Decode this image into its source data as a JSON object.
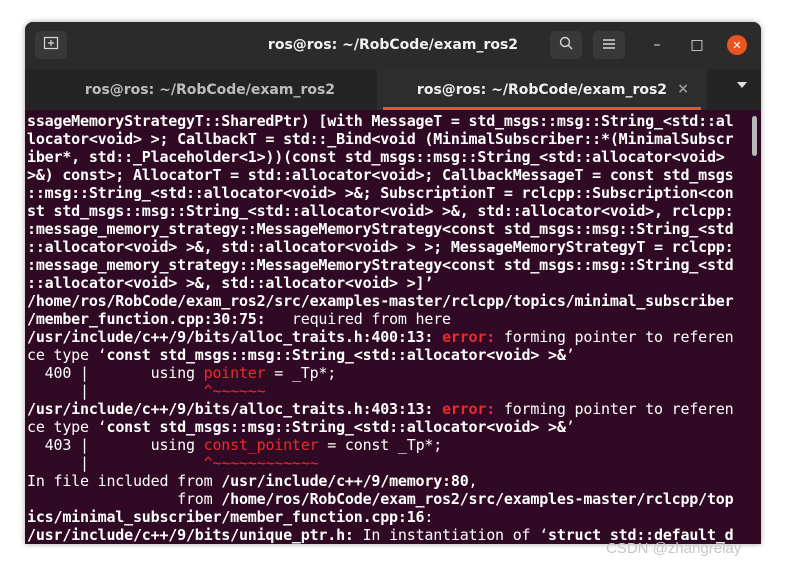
{
  "window": {
    "title": "ros@ros: ~/RobCode/exam_ros2",
    "new_tab_icon": "new-tab-icon",
    "search_icon": "search-icon",
    "menu_icon": "hamburger-menu-icon",
    "minimize": "–",
    "maximize": "□",
    "close": "✕"
  },
  "tabs": [
    {
      "label": "ros@ros: ~/RobCode/exam_ros2",
      "active": false
    },
    {
      "label": "ros@ros: ~/RobCode/exam_ros2",
      "active": true,
      "close": "×"
    }
  ],
  "terminal": {
    "lines": [
      "ssageMemoryStrategyT::SharedPtr) [with MessageT = std_msgs::msg::String_<std::al",
      "locator<void> >; CallbackT = std::_Bind<void (MinimalSubscriber::*(MinimalSubscr",
      "iber*, std::_Placeholder<1>))(const std_msgs::msg::String_<std::allocator<void> ",
      ">&) const>; AllocatorT = std::allocator<void>; CallbackMessageT = const std_msgs",
      "::msg::String_<std::allocator<void> >&; SubscriptionT = rclcpp::Subscription<con",
      "st std_msgs::msg::String_<std::allocator<void> >&, std::allocator<void>, rclcpp:",
      ":message_memory_strategy::MessageMemoryStrategy<const std_msgs::msg::String_<std",
      "::allocator<void> >&, std::allocator<void> > >; MessageMemoryStrategyT = rclcpp:",
      ":message_memory_strategy::MessageMemoryStrategy<const std_msgs::msg::String_<std",
      "::allocator<void> >&, std::allocator<void> >]’"
    ],
    "l11_bold": "/home/ros/RobCode/exam_ros2/src/examples-master/rclcpp/topics/minimal_subscriber",
    "l12_bold": "/member_function.cpp:30:75:",
    "l12_rest": "   required from here",
    "l13_bold": "/usr/include/c++/9/bits/alloc_traits.h:400:13:",
    "l13_err": "error:",
    "l13_rest": " forming pointer to referen",
    "l14_a": "ce type ‘",
    "l14_bold": "const std_msgs::msg::String_<std::allocator<void> >&",
    "l14_b": "’",
    "l15_a": "  400 |       using ",
    "l15_red": "pointer",
    "l15_b": " = _Tp*;",
    "l16_a": "      |             ",
    "l16_red": "^~~~~~~",
    "l17_bold": "/usr/include/c++/9/bits/alloc_traits.h:403:13:",
    "l17_err": "error:",
    "l17_rest": " forming pointer to referen",
    "l18_a": "ce type ‘",
    "l18_bold": "const std_msgs::msg::String_<std::allocator<void> >&",
    "l18_b": "’",
    "l19_a": "  403 |       using ",
    "l19_red": "const_pointer",
    "l19_b": " = const _Tp*;",
    "l20_a": "      |             ",
    "l20_red": "^~~~~~~~~~~~~",
    "l21_a": "In file included from ",
    "l21_bold": "/usr/include/c++/9/memory:80",
    "l21_b": ",",
    "l22_a": "                 from ",
    "l22_bold": "/home/ros/RobCode/exam_ros2/src/examples-master/rclcpp/top",
    "l23_bold": "ics/minimal_subscriber/member_function.cpp:16",
    "l23_b": ":",
    "l24_bold": "/usr/include/c++/9/bits/unique_ptr.h:",
    "l24_a": " In instantiation of ‘",
    "l24_bold2": "struct std::default_d"
  },
  "watermark": "CSDN @zhangrelay"
}
